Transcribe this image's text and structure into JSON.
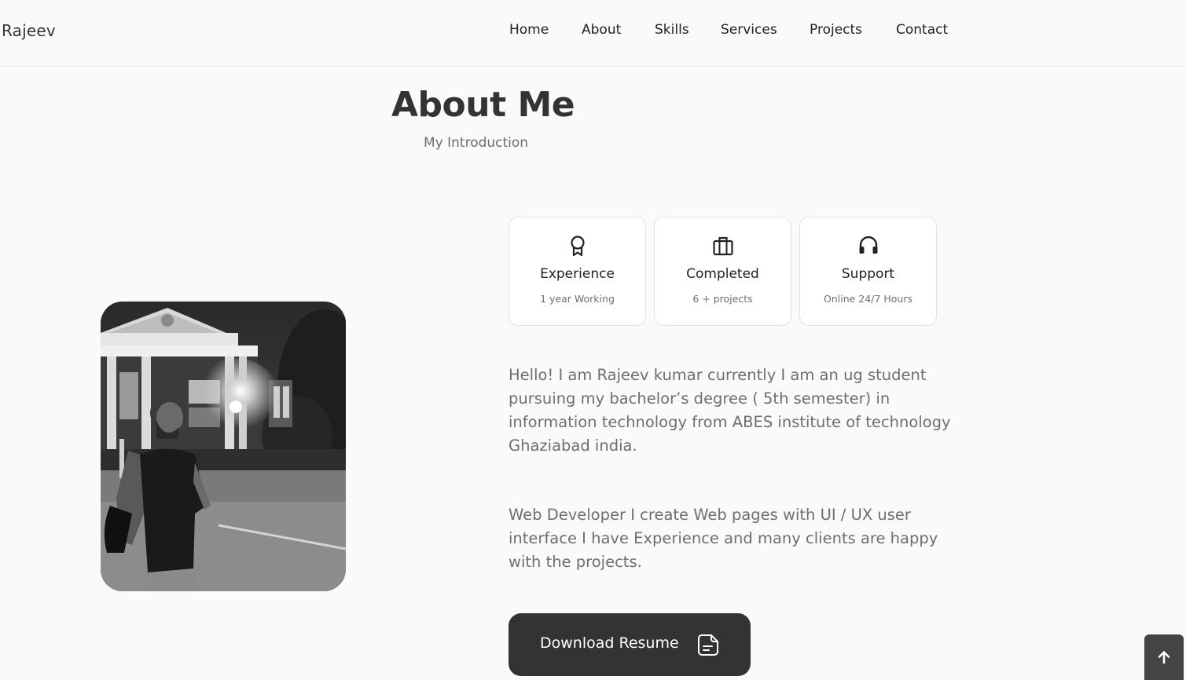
{
  "header": {
    "logo": "Rajeev",
    "nav": [
      "Home",
      "About",
      "Skills",
      "Services",
      "Projects",
      "Contact"
    ]
  },
  "about": {
    "title": "About Me",
    "subtitle": "My Introduction",
    "cards": [
      {
        "icon": "award-icon",
        "title": "Experience",
        "subtitle": "1 year Working"
      },
      {
        "icon": "briefcase-icon",
        "title": "Completed",
        "subtitle": "6 + projects"
      },
      {
        "icon": "headset-icon",
        "title": "Support",
        "subtitle": "Online 24/7 Hours"
      }
    ],
    "paragraph1": "Hello! I am Rajeev kumar currently I am an ug student pursuing my bachelor’s degree ( 5th semester) in information technology from ABES institute of technology Ghaziabad india.",
    "paragraph2": "Web Developer I create Web pages with UI / UX user interface I have Experience and many clients are happy with the projects.",
    "download_label": "Download Resume"
  },
  "colors": {
    "background": "#fafafa",
    "button": "#333333",
    "text_muted": "#6e6e6e"
  }
}
